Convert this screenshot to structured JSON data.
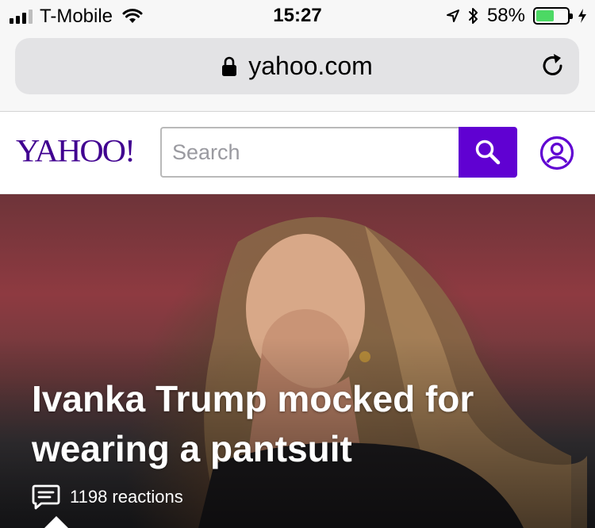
{
  "status_bar": {
    "carrier": "T-Mobile",
    "time": "15:27",
    "battery_percent": "58%",
    "battery_level": 0.58,
    "icons": [
      "signal-icon",
      "wifi-icon",
      "location-arrow-icon",
      "bluetooth-icon",
      "battery-icon",
      "charging-bolt-icon"
    ]
  },
  "browser": {
    "url": "yahoo.com",
    "icons": [
      "lock-icon",
      "reload-icon"
    ]
  },
  "header": {
    "logo": "YAHOO!",
    "search_placeholder": "Search",
    "search_value": "",
    "accent_color": "#6001d2",
    "logo_color": "#400090",
    "icons": [
      "search-icon",
      "profile-icon"
    ]
  },
  "hero": {
    "headline": "Ivanka Trump mocked for wearing a pantsuit",
    "reactions": "1198 reactions",
    "icons": [
      "comment-icon"
    ]
  }
}
